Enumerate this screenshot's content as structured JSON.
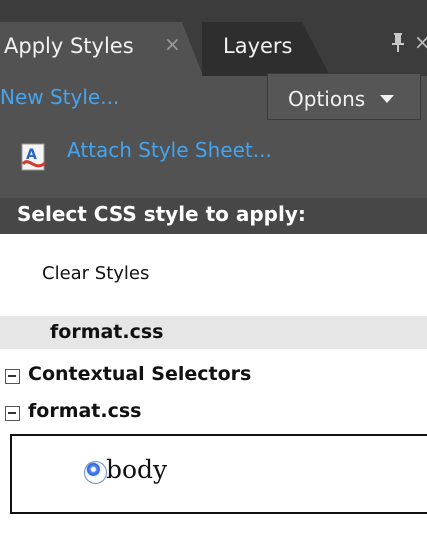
{
  "tabs": [
    {
      "label": "Apply Styles",
      "active": true,
      "close_glyph": "×"
    },
    {
      "label": "Layers",
      "active": false
    }
  ],
  "panel_controls": {
    "pin_icon": "pin-icon",
    "overflow_glyph": "×"
  },
  "toolbar": {
    "new_style_label": "New Style...",
    "options_label": "Options",
    "attach_label": "Attach Style Sheet..."
  },
  "select_label": "Select CSS style to apply:",
  "list": {
    "clear_styles_label": "Clear Styles",
    "group_header": "format.css",
    "tree": [
      {
        "label": "Contextual Selectors",
        "collapse_glyph": "−"
      },
      {
        "label": "format.css",
        "collapse_glyph": "−"
      }
    ],
    "selected_rule": "body"
  },
  "colors": {
    "tab_bg": "#3c3c3c",
    "active_tab": "#525252",
    "link": "#43a4ef",
    "header_bar": "#474747",
    "group_bg": "#e6e6e6",
    "rule_dot": "#2f60d8"
  }
}
